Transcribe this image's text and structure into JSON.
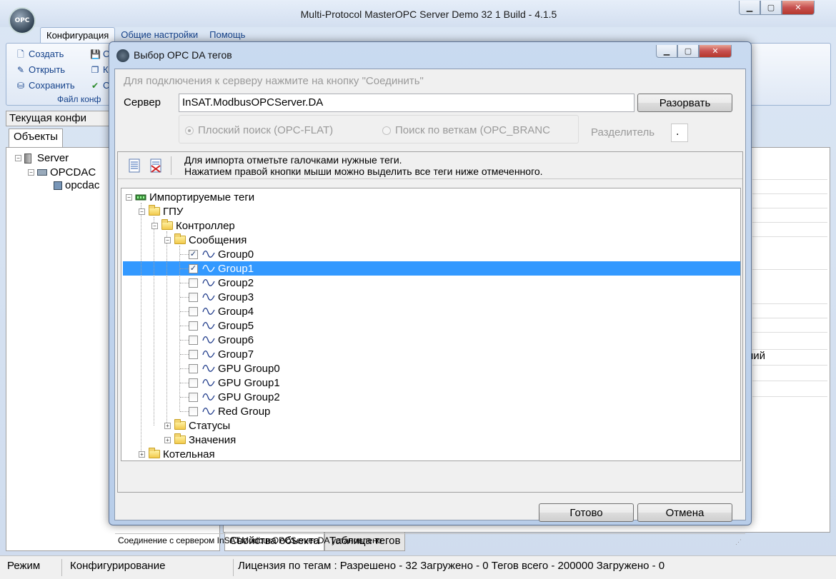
{
  "main_window": {
    "title": "Multi-Protocol MasterOPC Server Demo 32 1 Build - 4.1.5",
    "logo_text": "OPC",
    "ribbon_tabs": [
      "Конфигурация",
      "Общие настройки",
      "Помощь"
    ],
    "ribbon_items_col1": [
      "Создать",
      "Открыть",
      "Сохранить"
    ],
    "ribbon_items_col2": [
      "С",
      "К",
      "С"
    ],
    "ribbon_group_label": "Файл конф",
    "current_config_label": "Текущая конфи",
    "objects_tab": "Объекты",
    "tree": [
      {
        "label": "Server",
        "toggle": "−"
      },
      {
        "label": "OPCDAC",
        "toggle": "−"
      },
      {
        "label": "opcdac",
        "toggle": ""
      }
    ],
    "right_partial_text": "ний",
    "bottom_tabs": [
      "Свойства объекта",
      "Таблица тегов"
    ],
    "status": {
      "mode_label": "Режим",
      "mode_value": "Конфигурирование",
      "license": "Лицензия по тегам : Разрешено - 32 Загружено - 0 Тегов всего - 200000 Загружено - 0"
    }
  },
  "dialog": {
    "title": "Выбор OPC DA тегов",
    "connect_hint": "Для подключения к серверу нажмите на кнопку \"Соединить\"",
    "server_label": "Сервер",
    "server_value": "InSAT.ModbusOPCServer.DA",
    "disconnect_button": "Разорвать",
    "search_flat": "Плоский поиск (OPC-FLAT)",
    "search_branch": "Поиск по веткам (OPC_BRANC",
    "separator_label": "Разделитель",
    "separator_value": ".",
    "hint_line1": "Для импорта отметьте галочками нужные теги.",
    "hint_line2": "Нажатием правой кнопки мыши можно выделить все теги ниже отмеченного.",
    "tree": {
      "root": "Импортируемые теги",
      "gpu": "ГПУ",
      "controller": "Контроллер",
      "messages": "Сообщения",
      "tags": [
        {
          "label": "Group0",
          "checked": true
        },
        {
          "label": "Group1",
          "checked": true,
          "selected": true
        },
        {
          "label": "Group2",
          "checked": false
        },
        {
          "label": "Group3",
          "checked": false
        },
        {
          "label": "Group4",
          "checked": false
        },
        {
          "label": "Group5",
          "checked": false
        },
        {
          "label": "Group6",
          "checked": false
        },
        {
          "label": "Group7",
          "checked": false
        },
        {
          "label": "GPU Group0",
          "checked": false
        },
        {
          "label": "GPU Group1",
          "checked": false
        },
        {
          "label": "GPU Group2",
          "checked": false
        },
        {
          "label": "Red Group",
          "checked": false
        }
      ],
      "statuses": "Статусы",
      "values": "Значения",
      "boiler": "Котельная"
    },
    "done_button": "Готово",
    "cancel_button": "Отмена",
    "status_text": "Соединение с сервером InSAT.ModbusOPCServer.DA установлено"
  },
  "colors": {
    "selection": "#3399ff",
    "title_bg": "#dbe6f4",
    "link": "#15428b"
  }
}
